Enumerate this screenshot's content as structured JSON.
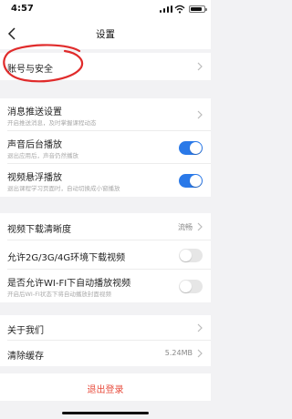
{
  "status_bar": {
    "time": "4:57",
    "battery_level": 0.85
  },
  "nav": {
    "title": "设置"
  },
  "account": {
    "label": "账号与安全"
  },
  "notifications": {
    "push": {
      "title": "消息推送设置",
      "subtitle": "开启推送消息，及时掌握课程动态"
    },
    "background_audio": {
      "title": "声音后台播放",
      "subtitle": "退出应用后，声音仍然播放",
      "enabled": true
    },
    "floating_video": {
      "title": "视频悬浮播放",
      "subtitle": "退出课程学习页面时，自动切换成小窗播放",
      "enabled": true
    }
  },
  "download": {
    "quality": {
      "title": "视频下载清晰度",
      "value": "流畅"
    },
    "mobile_data": {
      "title": "允许2G/3G/4G环境下载视频",
      "enabled": false
    },
    "wifi_auto": {
      "title": "是否允许WI-FI下自动播放视频",
      "subtitle": "开启后WI-FI状态下将自动播放封面视频",
      "enabled": false
    }
  },
  "about": {
    "about_us": {
      "title": "关于我们"
    },
    "clear_cache": {
      "title": "清除缓存",
      "value": "5.24MB"
    }
  },
  "logout": {
    "label": "退出登录"
  },
  "colors": {
    "accent": "#2a79e8",
    "danger": "#e84c3d",
    "annotation": "#e02b2b"
  },
  "icons": {
    "back": "chevron-left-icon",
    "row_arrow": "chevron-right-icon",
    "signal": "signal-icon",
    "wifi": "wifi-icon",
    "battery": "battery-icon"
  }
}
